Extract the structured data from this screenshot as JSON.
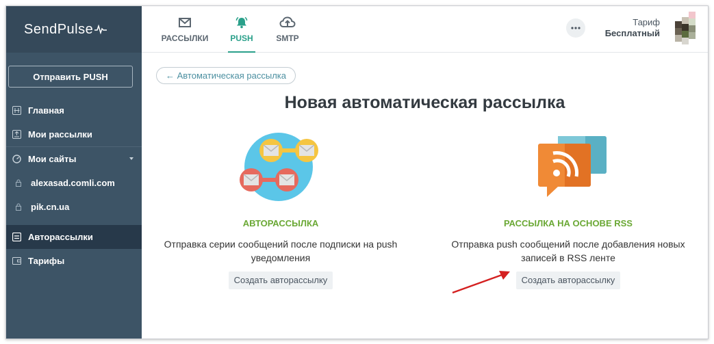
{
  "app": {
    "logo": "SendPulse"
  },
  "sidebar": {
    "send_push_label": "Отправить PUSH",
    "items": [
      {
        "label": "Главная",
        "icon": "home-icon"
      },
      {
        "label": "Мои рассылки",
        "icon": "mailings-icon"
      },
      {
        "label": "Мои сайты",
        "icon": "sites-icon"
      },
      {
        "label": "alexasad.comli.com",
        "icon": "lock-icon"
      },
      {
        "label": "pik.cn.ua",
        "icon": "lock-icon"
      },
      {
        "label": "Авторассылки",
        "icon": "autoresponder-icon"
      },
      {
        "label": "Тарифы",
        "icon": "wallet-icon"
      }
    ]
  },
  "topbar": {
    "tabs": [
      {
        "label": "РАССЫЛКИ",
        "icon": "envelope-icon"
      },
      {
        "label": "PUSH",
        "icon": "bell-icon"
      },
      {
        "label": "SMTP",
        "icon": "cloud-upload-icon"
      }
    ],
    "plan_label": "Тариф",
    "plan_value": "Бесплатный"
  },
  "main": {
    "back_label": "← Автоматическая рассылка",
    "title": "Новая автоматическая рассылка",
    "cards": [
      {
        "title": "АВТОРАССЫЛКА",
        "description": "Отправка серии сообщений после подписки на push уведомления",
        "button": "Создать авторассылку"
      },
      {
        "title": "РАССЫЛКА НА ОСНОВЕ RSS",
        "description": "Отправка push сообщений после добавления новых записей в RSS ленте",
        "button": "Создать авторассылку"
      }
    ]
  },
  "colors": {
    "sidebar": "#3d5466",
    "sidebar_active": "#27394a",
    "accent_green": "#2aa08a",
    "card_title_green": "#6aa834"
  }
}
